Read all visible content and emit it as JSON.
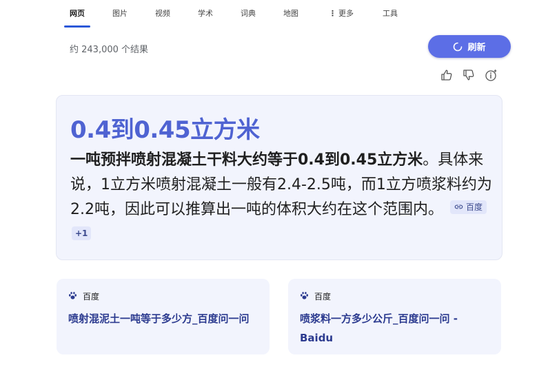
{
  "nav": {
    "tabs": [
      {
        "label": "网页",
        "active": true
      },
      {
        "label": "图片",
        "active": false
      },
      {
        "label": "视频",
        "active": false
      },
      {
        "label": "学术",
        "active": false
      },
      {
        "label": "词典",
        "active": false
      },
      {
        "label": "地图",
        "active": false
      },
      {
        "label": "更多",
        "active": false
      },
      {
        "label": "工具",
        "active": false
      }
    ]
  },
  "results": {
    "count_text": "约 243,000 个结果",
    "refresh_label": "刷新",
    "refresh_icon": "refresh-icon",
    "feedback_icons": [
      "thumbs-up-icon",
      "thumbs-down-icon",
      "info-sparkle-icon"
    ]
  },
  "answer": {
    "title": "0.4到0.45立方米",
    "bold_sentence": "一吨预拌喷射混凝土干料大约等于0.4到0.45立方米",
    "rest": "。具体来说，1立方米喷射混凝土一般有2.4-2.5吨，而1立方喷浆料约为2.2吨，因此可以推算出一吨的体积大约在这个范围内。",
    "source_chip": "百度",
    "source_chip_icon": "link-icon",
    "more_sources": "+1"
  },
  "sources": [
    {
      "site": "百度",
      "icon": "baidu-paw-icon",
      "title": "喷射混泥土一吨等于多少方_百度问一问"
    },
    {
      "site": "百度",
      "icon": "baidu-paw-icon",
      "title": "喷浆料一方多少公斤_百度问一问 - Baidu"
    }
  ],
  "colors": {
    "accent": "#5c6ee6",
    "title_blue": "#4f63d2",
    "card_bg": "#f2f4fd",
    "link_title": "#2b3a8f",
    "tab_underline": "#2b58d8"
  }
}
